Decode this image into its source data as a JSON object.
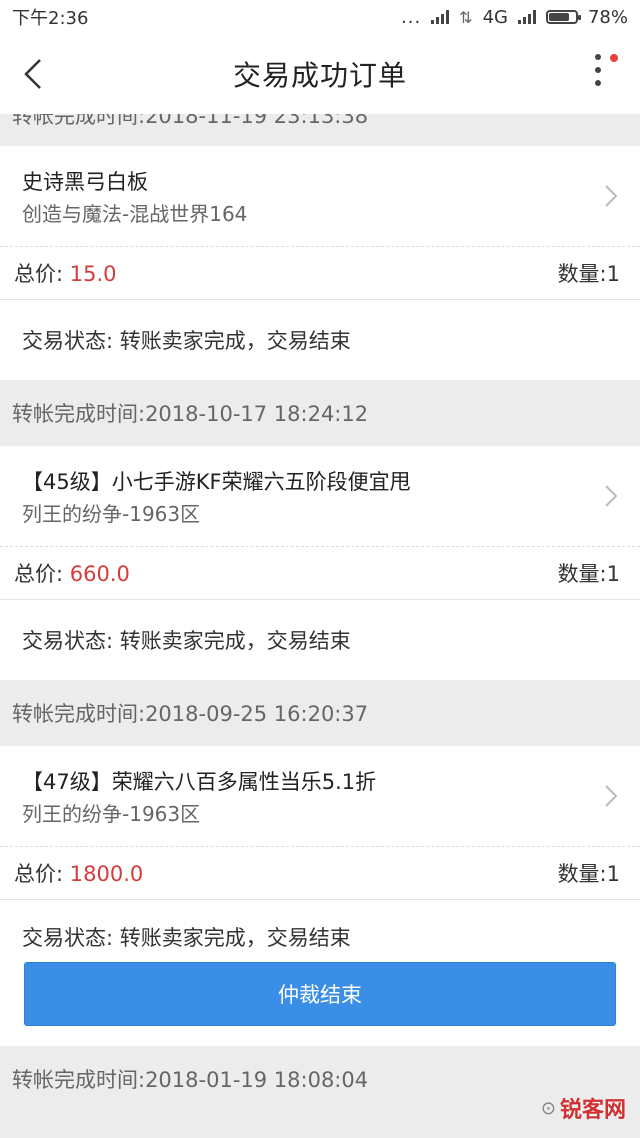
{
  "status_bar": {
    "time": "下午2:36",
    "dots": "...",
    "network": "4G",
    "battery": "78%",
    "battery_level": 0.78
  },
  "nav": {
    "title": "交易成功订单"
  },
  "orders": [
    {
      "item_title": "史诗黑弓白板",
      "item_server": "创造与魔法-混战世界164",
      "price_label": "总价: ",
      "price": "15.0",
      "qty": "数量:1",
      "status": "交易状态: 转账卖家完成，交易结束"
    },
    {
      "header": "转帐完成时间:2018-10-17 18:24:12",
      "item_title": "【45级】小七手游KF荣耀六五阶段便宜甩",
      "item_server": "列王的纷争-1963区",
      "price_label": "总价: ",
      "price": "660.0",
      "qty": "数量:1",
      "status": "交易状态: 转账卖家完成，交易结束"
    },
    {
      "header": "转帐完成时间:2018-09-25 16:20:37",
      "item_title": "【47级】荣耀六八百多属性当乐5.1折",
      "item_server": "列王的纷争-1963区",
      "price_label": "总价: ",
      "price": "1800.0",
      "qty": "数量:1",
      "status": "交易状态: 转账卖家完成，交易结束",
      "button": "仲裁结束"
    }
  ],
  "last_header": "转帐完成时间:2018-01-19 18:08:04",
  "watermark": {
    "brand": "锐客网"
  },
  "colors": {
    "price_red": "#d63b3b",
    "button_blue": "#3a8ee6"
  }
}
